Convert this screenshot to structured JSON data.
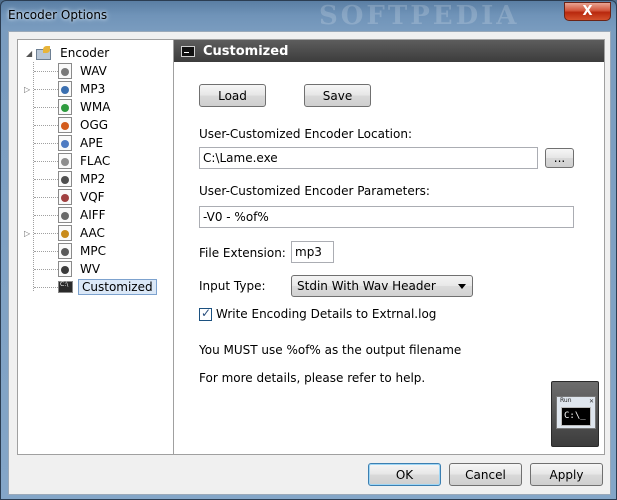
{
  "window": {
    "title": "Encoder Options",
    "watermark": "SOFTPEDIA",
    "close_symbol": "X"
  },
  "tree": {
    "root_label": "Encoder",
    "items": [
      {
        "label": "WAV",
        "color": "#7a7a7a",
        "expandable": false
      },
      {
        "label": "MP3",
        "color": "#3a6fb0",
        "expandable": true
      },
      {
        "label": "WMA",
        "color": "#2e9b3e",
        "expandable": false
      },
      {
        "label": "OGG",
        "color": "#d35b1b",
        "expandable": false
      },
      {
        "label": "APE",
        "color": "#4e7bc2",
        "expandable": false
      },
      {
        "label": "FLAC",
        "color": "#8e8e8e",
        "expandable": false
      },
      {
        "label": "MP2",
        "color": "#4e4e4e",
        "expandable": false
      },
      {
        "label": "VQF",
        "color": "#a04040",
        "expandable": false
      },
      {
        "label": "AIFF",
        "color": "#6a6a6a",
        "expandable": false
      },
      {
        "label": "AAC",
        "color": "#c88a1a",
        "expandable": true
      },
      {
        "label": "MPC",
        "color": "#5a5a5a",
        "expandable": false
      },
      {
        "label": "WV",
        "color": "#3b3b3b",
        "expandable": false
      },
      {
        "label": "Customized",
        "color": "#222222",
        "expandable": false,
        "selected": true
      }
    ]
  },
  "panel": {
    "title": "Customized",
    "load_label": "Load",
    "save_label": "Save",
    "location_label": "User-Customized Encoder Location:",
    "location_value": "C:\\Lame.exe",
    "browse_label": "...",
    "params_label": "User-Customized Encoder Parameters:",
    "params_value": "-V0 - %of%",
    "ext_label": "File Extension:",
    "ext_value": "mp3",
    "input_type_label": "Input Type:",
    "input_type_value": "Stdin With Wav Header",
    "write_details_label": "Write Encoding Details to Extrnal.log",
    "write_details_checked": true,
    "note_must": "You MUST use %of% as the output filename",
    "note_details": "For more details, please refer to help."
  },
  "run_thumb": {
    "title": "Run",
    "prompt": "C:\\_"
  },
  "footer": {
    "ok_label": "OK",
    "cancel_label": "Cancel",
    "apply_label": "Apply"
  }
}
